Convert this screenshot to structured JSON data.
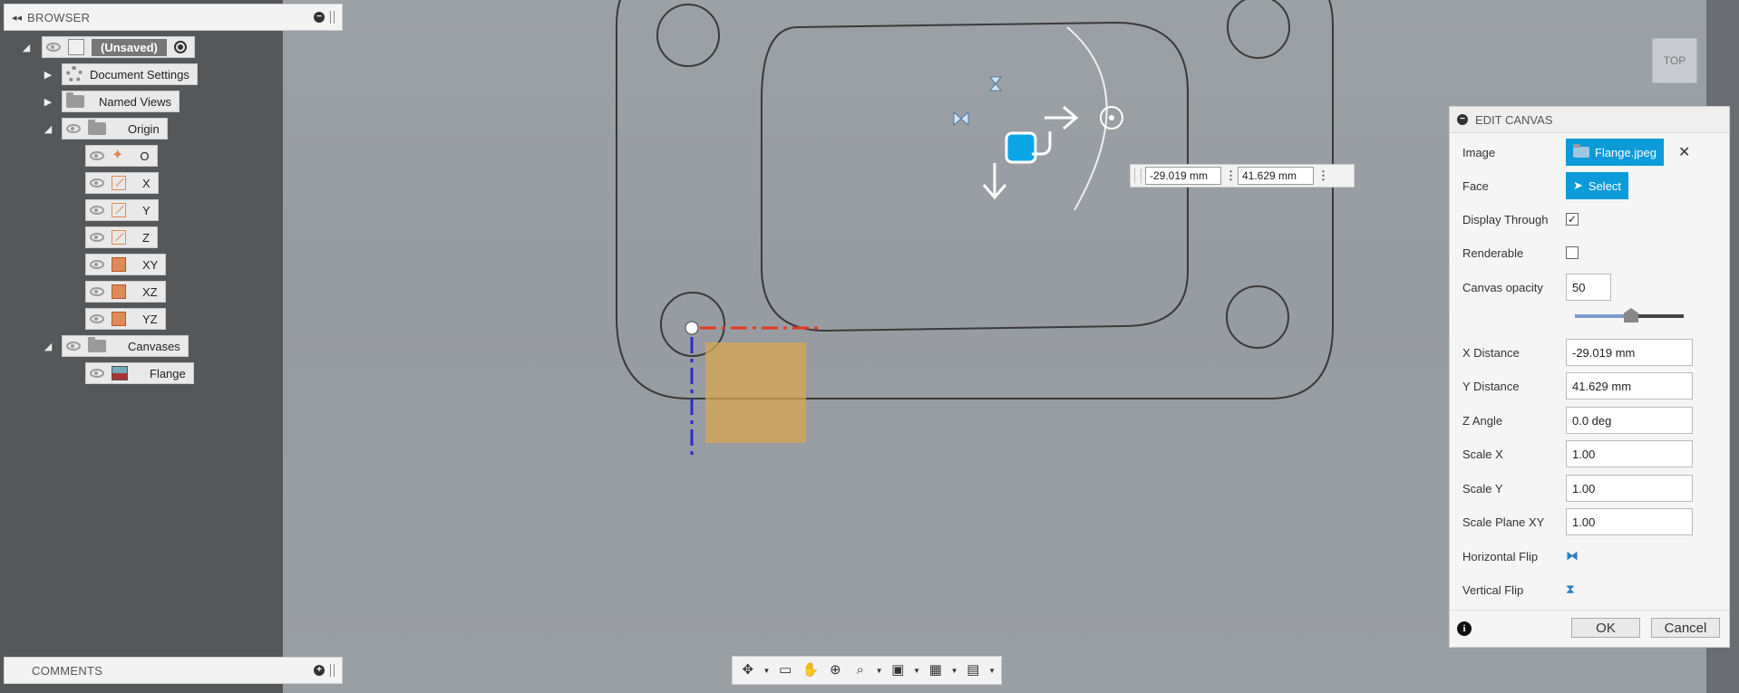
{
  "browser": {
    "title": "BROWSER",
    "tree": {
      "root": "(Unsaved)",
      "document_settings": "Document Settings",
      "named_views": "Named Views",
      "origin": "Origin",
      "origin_items": [
        "O",
        "X",
        "Y",
        "Z",
        "XY",
        "XZ",
        "YZ"
      ],
      "canvases": "Canvases",
      "canvas_item": "Flange"
    }
  },
  "comments": {
    "title": "COMMENTS"
  },
  "viewcube": {
    "label": "TOP"
  },
  "float_inputs": {
    "x": "-29.019 mm",
    "y": "41.629 mm"
  },
  "edit_canvas": {
    "title": "EDIT CANVAS",
    "image_label": "Image",
    "image_value": "Flange.jpeg",
    "face_label": "Face",
    "face_value": "Select",
    "display_through_label": "Display Through",
    "renderable_label": "Renderable",
    "opacity_label": "Canvas opacity",
    "opacity_value": "50",
    "opacity_level": 0.5,
    "x_distance_label": "X Distance",
    "x_distance_value": "-29.019 mm",
    "y_distance_label": "Y Distance",
    "y_distance_value": "41.629 mm",
    "z_angle_label": "Z Angle",
    "z_angle_value": "0.0 deg",
    "scale_x_label": "Scale X",
    "scale_x_value": "1.00",
    "scale_y_label": "Scale Y",
    "scale_y_value": "1.00",
    "scale_plane_label": "Scale Plane XY",
    "scale_plane_value": "1.00",
    "horizontal_flip_label": "Horizontal Flip",
    "vertical_flip_label": "Vertical Flip",
    "ok_label": "OK",
    "cancel_label": "Cancel"
  },
  "colors": {
    "accent_blue": "#0a9bd8",
    "panel_dark": "#555759",
    "origin_orange": "#e08a50"
  }
}
